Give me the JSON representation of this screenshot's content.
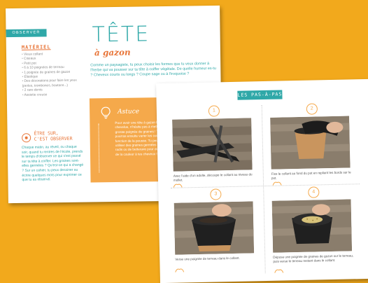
{
  "left_page": {
    "tag": "OBSERVER",
    "materiel": {
      "title": "MATÉRIEL",
      "items": [
        "Vieux collant",
        "Ciseaux",
        "Petit pot",
        "6 à 10 poignées de terreau",
        "1 poignée de graines de gazon",
        "Élastique",
        "Des décorations pour faire les yeux (perles, trombones, boutons...)",
        "2 rare-dents",
        "Assiette creuse"
      ]
    },
    "observe": {
      "heading_line1": "ÊTRE SUR,",
      "heading_line2": "C'EST OBSERVER",
      "text": "Chaque matin, au réveil, ou chaque soir, quand tu rentres de l'école, prends le temps d'observer ce qui s'est passé sur ta tête à coiffer. Les graines sont-elles germées ? Qu'est-ce qui a changé ? Sur un cahier, tu peux dessiner au écrire quelques mots pour exprimer ce que tu as observé."
    },
    "title": {
      "main": "TÊTE",
      "sub": "à gazon"
    },
    "intro": "Comme un paysagiste, tu peux choisir les formes que tu veux donner à l'herbe qui va pousser sur ta tête à coiffer végétale. De quelle humeur es-tu ? Cheveux courts ou longs ? Coupe sage ou à l'iroquoise ?",
    "astuce": {
      "title": "Astuce",
      "text": "Pour avoir une tête à gazon bien chevelue, n'hésite pas à mettre une grosse poignée de graines ! Tu pourras ensuite varier les coupes en fonction de la pousse. Tu peux aussi utiliser des graines germées de radis ou de betterave pour donner de la couleur à tes cheveux !"
    }
  },
  "right_page": {
    "banner": "LES PAS-À-PAS",
    "steps": [
      {
        "number": "1",
        "caption": "Avec l'aide d'un adulte, découpe le collant au niveau du mollet."
      },
      {
        "number": "2",
        "caption": "Fixe le collant au fond du pot en repliant les bords sur le pot."
      },
      {
        "number": "3",
        "caption": "Verse une poignée de terreau dans le collant."
      },
      {
        "number": "4",
        "caption": "Dépose une poignée de graines de gazon sur le terreau, puis verse le terreau restant dans le collant."
      }
    ]
  },
  "colors": {
    "background": "#f2a91c",
    "teal": "#2fa8a8",
    "orange": "#e8763a",
    "astuce_box": "#f5a94b"
  },
  "icons": [
    "lightbulb-icon",
    "eye-icon",
    "plant-sprout-icon"
  ]
}
